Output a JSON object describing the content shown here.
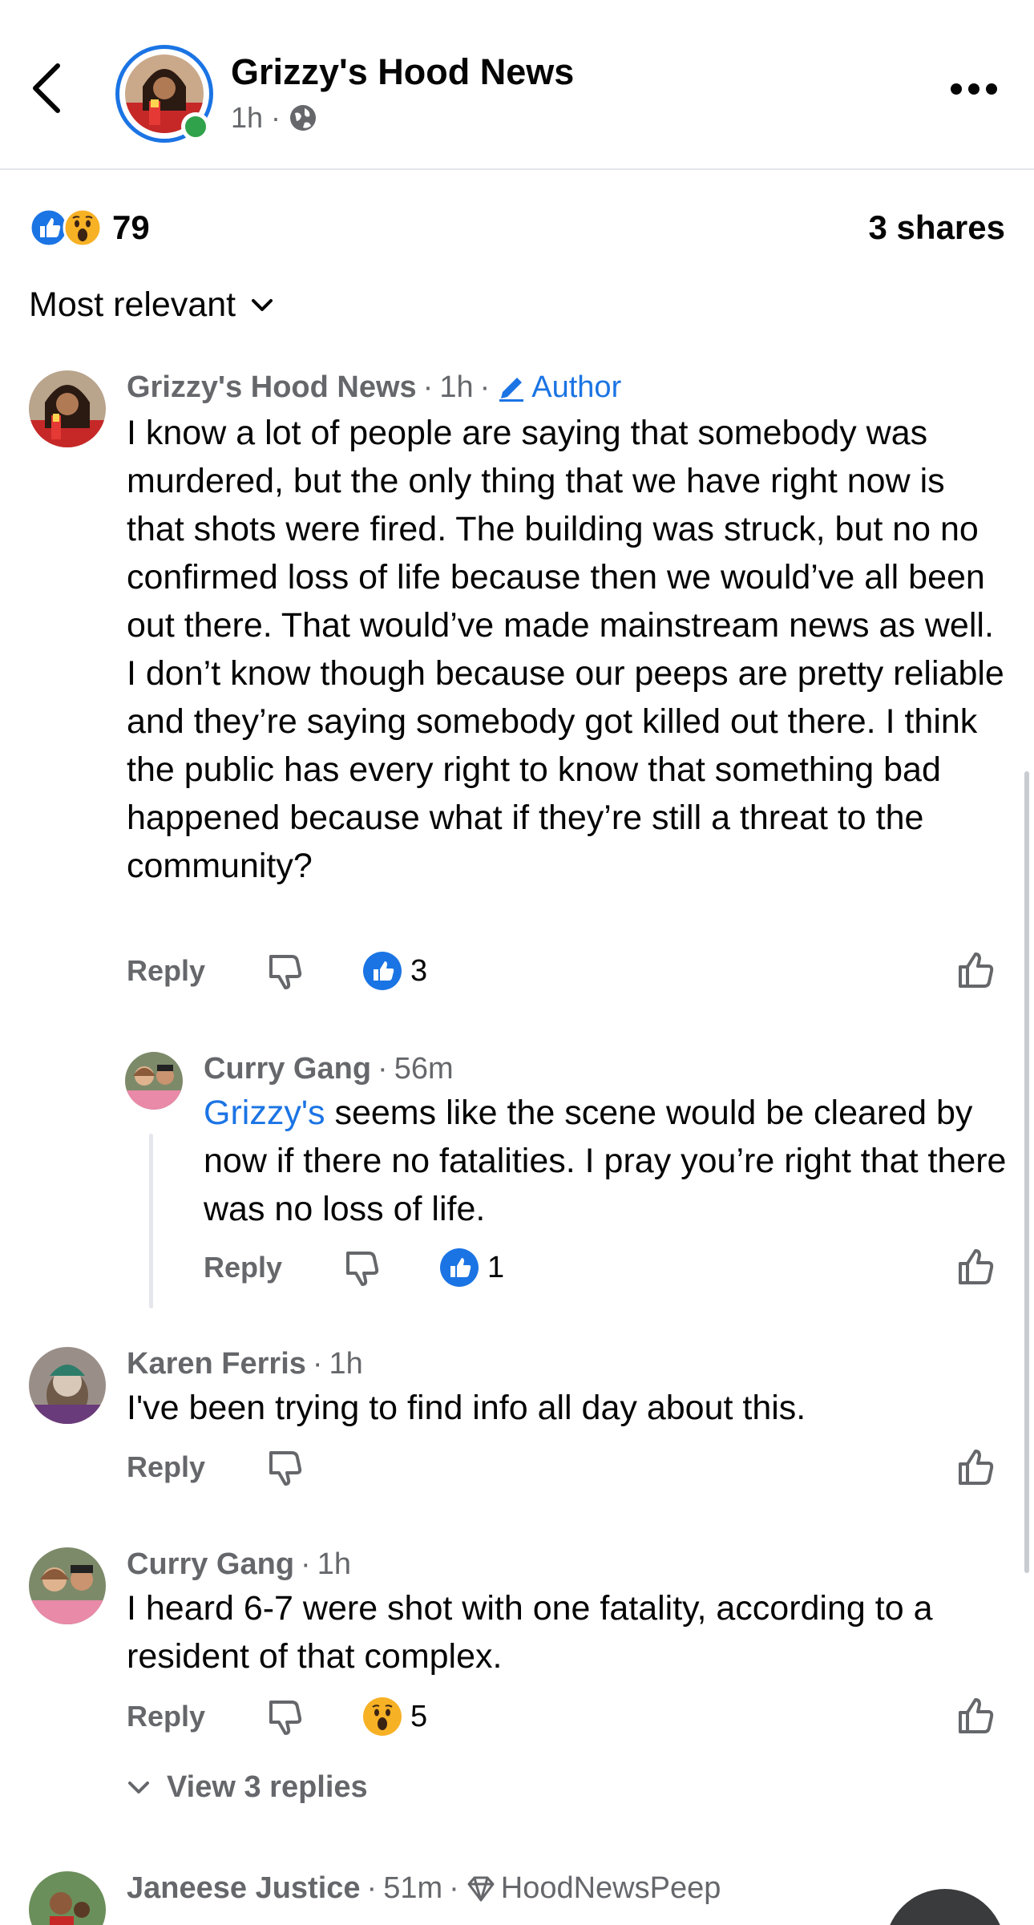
{
  "header": {
    "title": "Grizzy's Hood News",
    "time": "1h",
    "separator": "·"
  },
  "reactions": {
    "count": "79",
    "shares": "3 shares"
  },
  "sort": {
    "label": "Most relevant"
  },
  "comments": [
    {
      "name": "Grizzy's Hood News",
      "time": "1h",
      "badge": "Author",
      "text": "I know a lot of people are saying that somebody was murdered, but the only thing that we have right now is that shots were fired. The building was struck, but no no confirmed loss of life because then we would’ve all been out there. That would’ve made mainstream news as well. I don’t know though because our peeps are pretty reliable and they’re saying somebody got killed out there. I think the public has every right to know that something bad happened because what if they’re still a threat to the community?",
      "reply_label": "Reply",
      "reaction_count": "3"
    },
    {
      "name": "Curry Gang",
      "time": "56m",
      "mention": "Grizzy's",
      "text": " seems like the scene would be cleared by now if there no fatalities. I pray you’re right that there was no loss of life.",
      "reply_label": "Reply",
      "reaction_count": "1"
    },
    {
      "name": "Karen Ferris",
      "time": "1h",
      "text": "I've been trying to find info all day about this.",
      "reply_label": "Reply"
    },
    {
      "name": "Curry Gang",
      "time": "1h",
      "text": "I heard 6-7 were shot with one fatality, according to a resident of that complex.",
      "reply_label": "Reply",
      "reaction_count": "5"
    },
    {
      "name": "Janeese Justice",
      "time": "51m",
      "badge": "HoodNewsPeep"
    }
  ],
  "view_replies": "View 3 replies",
  "colors": {
    "accent": "#1b74e4",
    "online": "#31a24c",
    "secondary_text": "#65676b"
  },
  "icons": [
    "back-arrow-icon",
    "globe-icon",
    "more-icon",
    "like-reaction-icon",
    "wow-reaction-icon",
    "chevron-down-icon",
    "pencil-icon",
    "dislike-icon",
    "thumbs-up-outline-icon",
    "diamond-icon"
  ]
}
